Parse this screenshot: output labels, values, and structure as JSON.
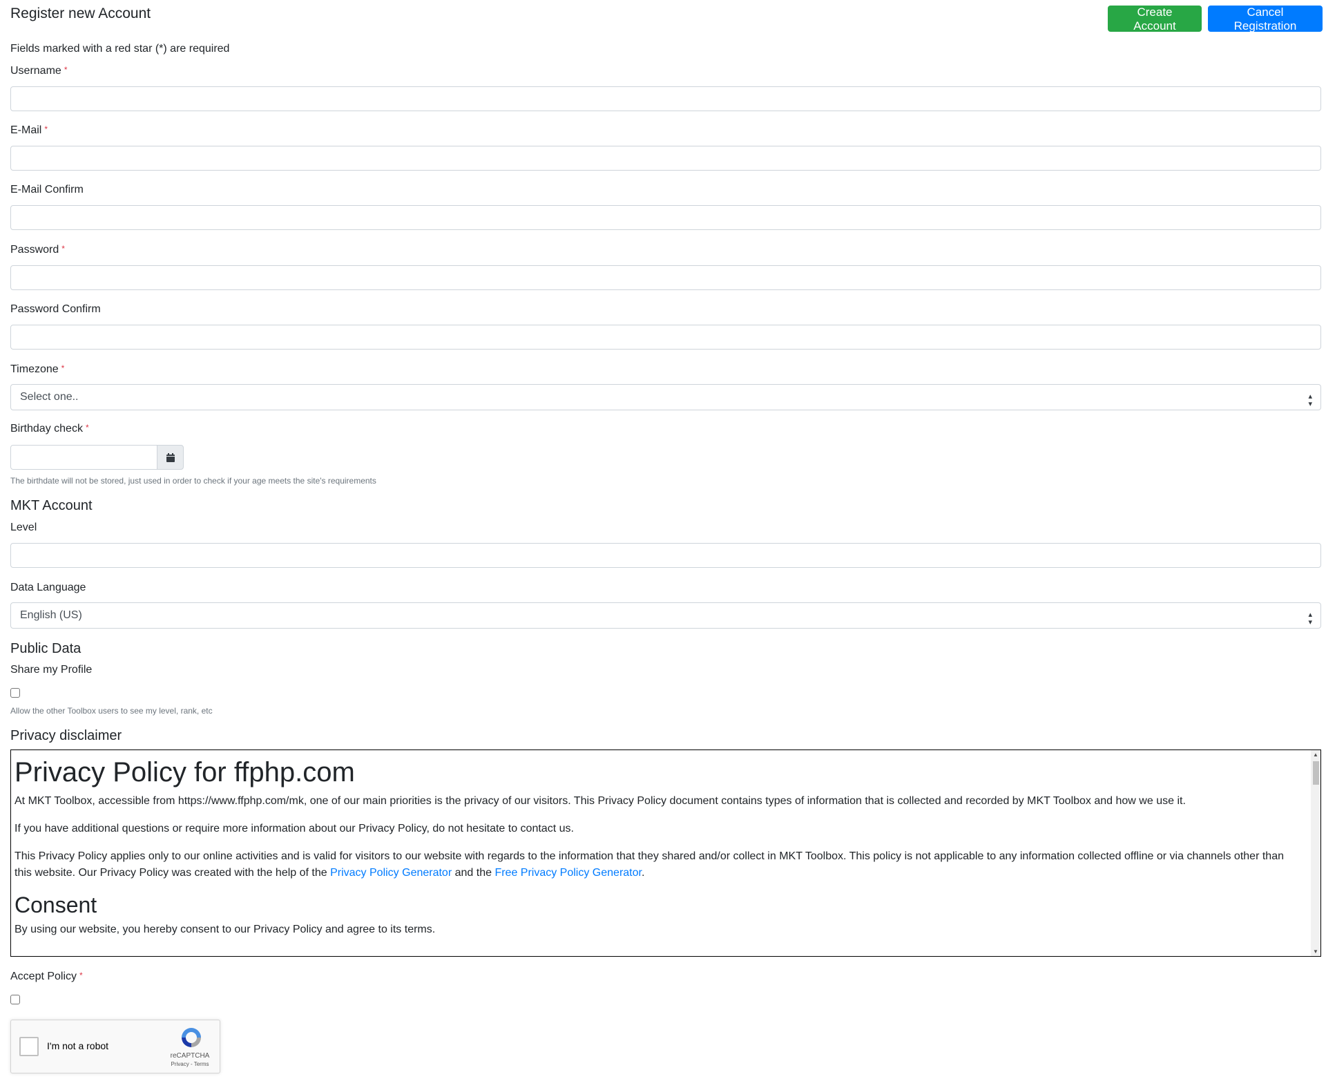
{
  "header": {
    "title": "Register new Account",
    "create_label": "Create Account",
    "cancel_label": "Cancel Registration"
  },
  "form": {
    "required_note": "Fields marked with a red star (*) are required",
    "required_marker": "*",
    "username_label": "Username",
    "email_label": "E-Mail",
    "email_confirm_label": "E-Mail Confirm",
    "password_label": "Password",
    "password_confirm_label": "Password Confirm",
    "timezone_label": "Timezone",
    "timezone_value": "Select one..",
    "birthday_label": "Birthday check",
    "birthday_help": "The birthdate will not be stored, just used in order to check if your age meets the site's requirements"
  },
  "mkt_account": {
    "heading": "MKT Account",
    "level_label": "Level",
    "data_language_label": "Data Language",
    "data_language_value": "English (US)"
  },
  "public_data": {
    "heading": "Public Data",
    "share_label": "Share my Profile",
    "share_checked": false,
    "share_help": "Allow the other Toolbox users to see my level, rank, etc"
  },
  "privacy": {
    "heading": "Privacy disclaimer",
    "title": "Privacy Policy for ffphp.com",
    "p1": "At MKT Toolbox, accessible from https://www.ffphp.com/mk, one of our main priorities is the privacy of our visitors. This Privacy Policy document contains types of information that is collected and recorded by MKT Toolbox and how we use it.",
    "p2": "If you have additional questions or require more information about our Privacy Policy, do not hesitate to contact us.",
    "p3_a": "This Privacy Policy applies only to our online activities and is valid for visitors to our website with regards to the information that they shared and/or collect in MKT Toolbox. This policy is not applicable to any information collected offline or via channels other than this website. Our Privacy Policy was created with the help of the ",
    "p3_link1": "Privacy Policy Generator",
    "p3_mid": " and the ",
    "p3_link2": "Free Privacy Policy Generator",
    "p3_end": ".",
    "consent_heading": "Consent",
    "consent_text": "By using our website, you hereby consent to our Privacy Policy and agree to its terms."
  },
  "accept": {
    "label": "Accept Policy",
    "checked": false
  },
  "captcha": {
    "label": "I'm not a robot",
    "brand": "reCAPTCHA",
    "terms": "Privacy - Terms"
  },
  "colors": {
    "create_button": "#28a745",
    "cancel_button": "#007bff",
    "required_star": "#dc3545",
    "link": "#007bff"
  }
}
